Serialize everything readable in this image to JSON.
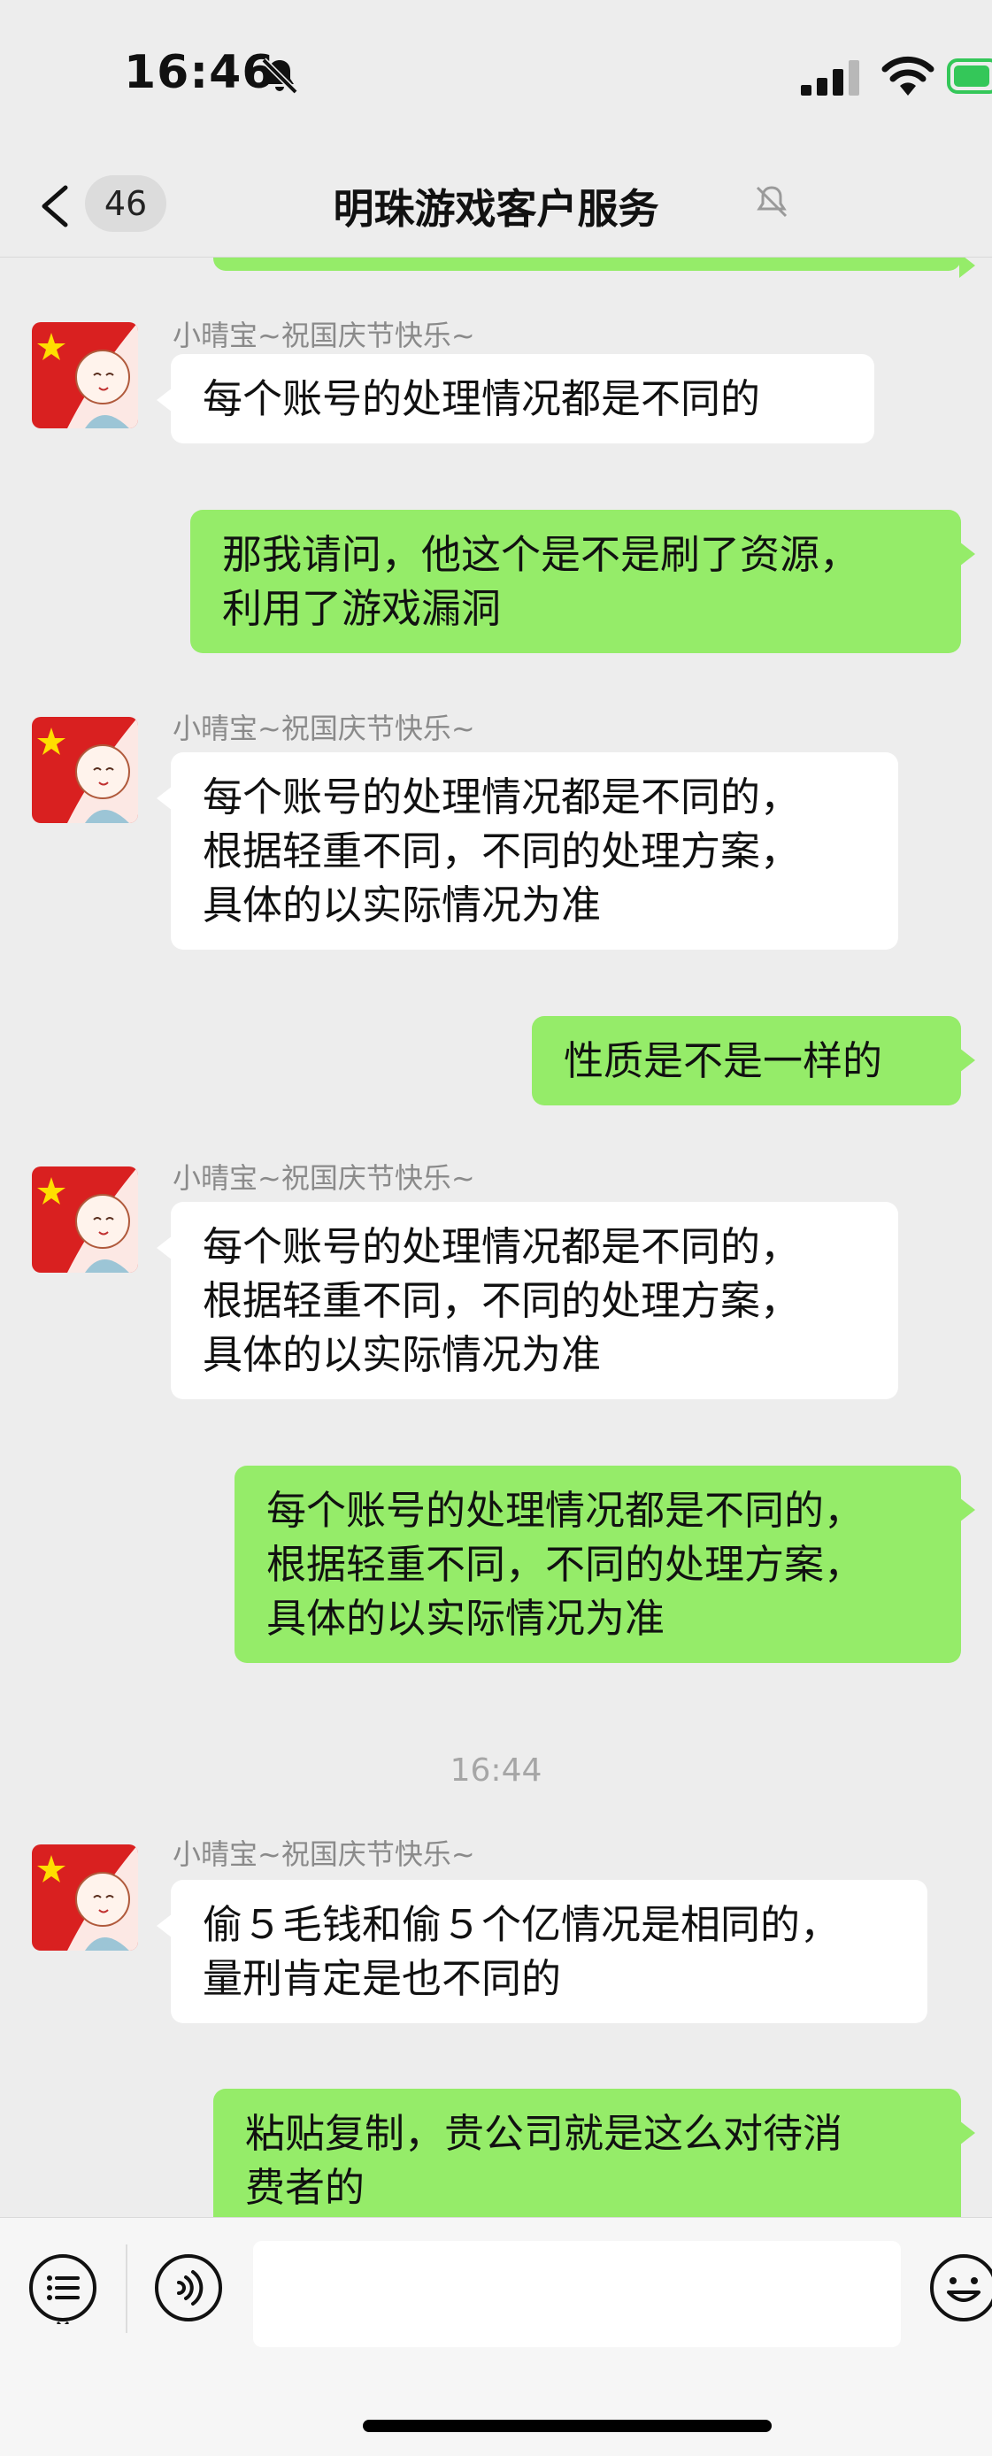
{
  "status_bar": {
    "time": "16:46"
  },
  "nav": {
    "back_count": "46",
    "title": "明珠游戏客户服务"
  },
  "messages": [
    {
      "type": "incoming",
      "sender": "小晴宝~祝国庆节快乐~",
      "text": "每个账号的处理情况都是不同的"
    },
    {
      "type": "outgoing",
      "text": "那我请问，他这个是不是刷了资源，\n利用了游戏漏洞"
    },
    {
      "type": "incoming",
      "sender": "小晴宝~祝国庆节快乐~",
      "text": "每个账号的处理情况都是不同的，\n根据轻重不同，不同的处理方案，\n具体的以实际情况为准"
    },
    {
      "type": "outgoing",
      "text": "性质是不是一样的"
    },
    {
      "type": "incoming",
      "sender": "小晴宝~祝国庆节快乐~",
      "text": "每个账号的处理情况都是不同的，\n根据轻重不同，不同的处理方案，\n具体的以实际情况为准"
    },
    {
      "type": "outgoing",
      "text": "每个账号的处理情况都是不同的，\n根据轻重不同，不同的处理方案，\n具体的以实际情况为准"
    },
    {
      "type": "timestamp",
      "text": "16:44"
    },
    {
      "type": "incoming",
      "sender": "小晴宝~祝国庆节快乐~",
      "text": "偷５毛钱和偷５个亿情况是相同的，\n量刑肯定是也不同的"
    },
    {
      "type": "outgoing",
      "text": "粘贴复制，贵公司就是这么对待消\n费者的"
    }
  ],
  "input_bar": {
    "placeholder": ""
  },
  "colors": {
    "background": "#EDEDED",
    "outgoing_bubble": "#95EC69",
    "incoming_bubble": "#FFFFFF",
    "battery": "#34C759"
  }
}
